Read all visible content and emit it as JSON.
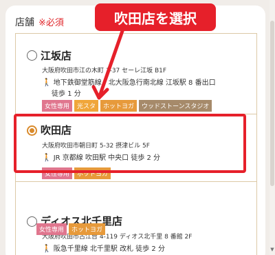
{
  "form": {
    "label": "店舗",
    "required": "※必須"
  },
  "callout": {
    "text": "吹田店を選択"
  },
  "stores": [
    {
      "name": "江坂店",
      "address": "大阪府吹田市江の木町 1-37 セーレ江坂 B1F",
      "access_line1": "地下鉄御堂筋線・北大阪急行南北線 江坂駅 8 番出口",
      "access_line2": "徒歩 1 分",
      "tags": [
        "女性専用",
        "光スタ",
        "ホットヨガ",
        "ウッドストーンスタジオ"
      ],
      "selected": false
    },
    {
      "name": "吹田店",
      "address": "大阪府吹田市朝日町 5-32 摂津ビル 5F",
      "access_line1": "JR 京都線 吹田駅 中央口 徒歩 2 分",
      "tags": [
        "女性専用",
        "ホットヨガ"
      ],
      "selected": true
    },
    {
      "name": "ディオス北千里店",
      "address": "大阪府吹田市古江台 4-119 ディオス北千里 8 番館 2F",
      "access_line1": "阪急千里線 北千里駅 改札 徒歩 2 分",
      "tags": [
        "女性専用",
        "ホットヨガ"
      ],
      "selected": false
    }
  ],
  "colors": {
    "accent_red": "#e6202a",
    "radio_selected": "#d98a2b",
    "tag_pink": "#e0768e",
    "tag_orange": "#f0a63a",
    "tag_brown": "#a68a6a"
  }
}
